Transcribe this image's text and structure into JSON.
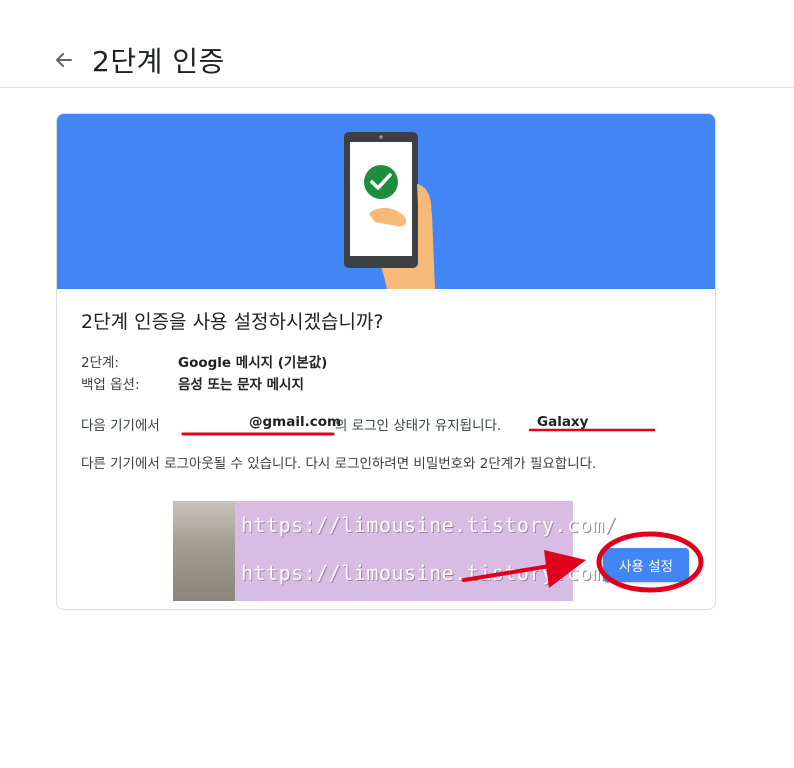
{
  "header": {
    "title": "2단계 인증",
    "back_icon": "arrow-left-icon"
  },
  "card": {
    "banner_color": "#4285f4",
    "question": "2단계 인증을 사용 설정하시겠습니까?",
    "info": {
      "second_step_label": "2단계:",
      "second_step_value": "Google 메시지 (기본값)",
      "backup_label": "백업 옵션:",
      "backup_value": "음성 또는 문자 메시지"
    },
    "device_prefix": "다음 기기에서",
    "email": "@gmail.com",
    "device_suffix": "의 로그인 상태가 유지됩니다.",
    "device_name": "Galaxy",
    "logout_text": "다른 기기에서 로그아웃될 수 있습니다. 다시 로그인하려면 비밀번호와 2단계가 필요합니다.",
    "enable_button": "사용 설정"
  },
  "watermark": {
    "line1": "https://limousine.tistory.com/",
    "line2": "https://limousine.tistory.com/"
  },
  "colors": {
    "accent": "#4285f4",
    "annotation_red": "#e0001b",
    "check_green": "#1e8e3e"
  }
}
